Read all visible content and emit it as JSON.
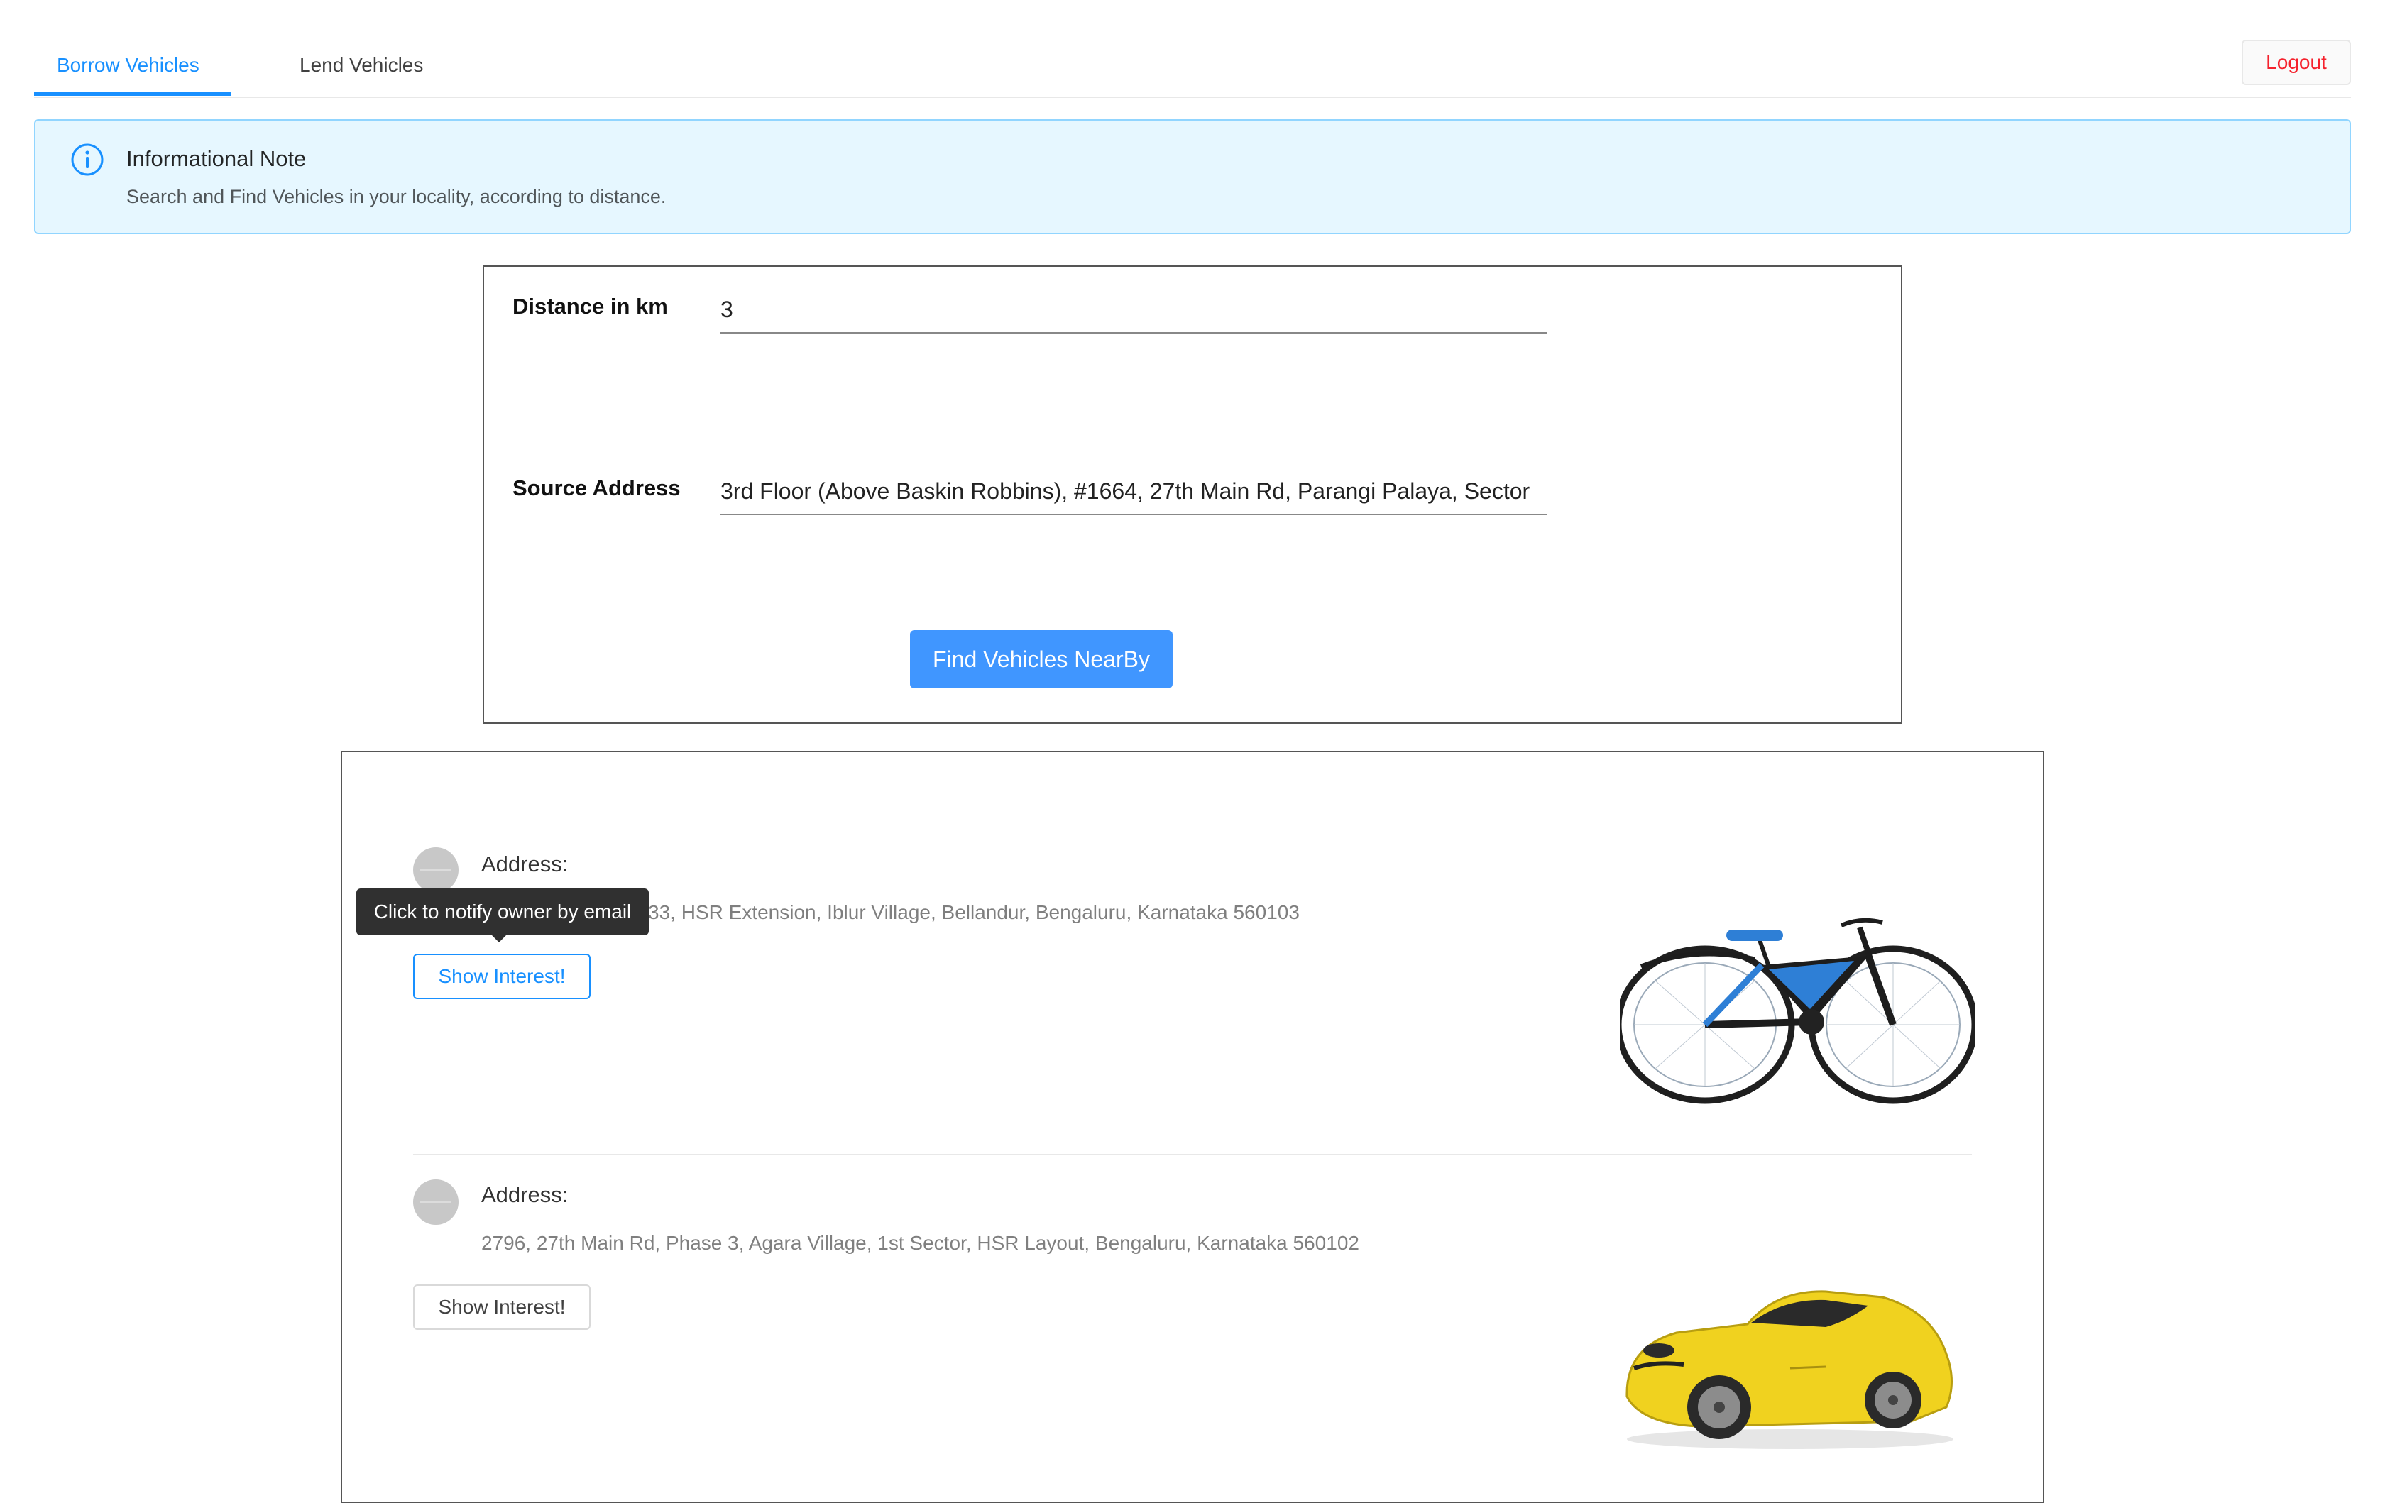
{
  "tabs": [
    {
      "label": "Borrow Vehicles",
      "active": true
    },
    {
      "label": "Lend Vehicles",
      "active": false
    }
  ],
  "logout_label": "Logout",
  "alert": {
    "icon": "info-icon",
    "title": "Informational Note",
    "description": "Search and Find Vehicles in your locality, according to distance."
  },
  "form": {
    "distance_label": "Distance in km",
    "distance_value": "3",
    "address_label": "Source Address",
    "address_value": "3rd Floor (Above Baskin Robbins), #1664, 27th Main Rd, Parangi Palaya, Sector",
    "submit_label": "Find Vehicles NearBy"
  },
  "results": [
    {
      "address_label": "Address:",
      "address": "Survey no 33, 833/33, HSR Extension, Iblur Village, Bellandur, Bengaluru, Karnataka 560103",
      "button_label": "Show Interest!",
      "tooltip": "Click to notify owner by email",
      "vehicle_image": "bicycle"
    },
    {
      "address_label": "Address:",
      "address": "2796, 27th Main Rd, Phase 3, Agara Village, 1st Sector, HSR Layout, Bengaluru, Karnataka 560102",
      "button_label": "Show Interest!",
      "vehicle_image": "yellow-convertible-car"
    }
  ],
  "colors": {
    "primary": "#1890ff",
    "alert_bg": "#e6f7ff",
    "logout_text": "#f5222d",
    "button_blue": "#4096ff"
  }
}
